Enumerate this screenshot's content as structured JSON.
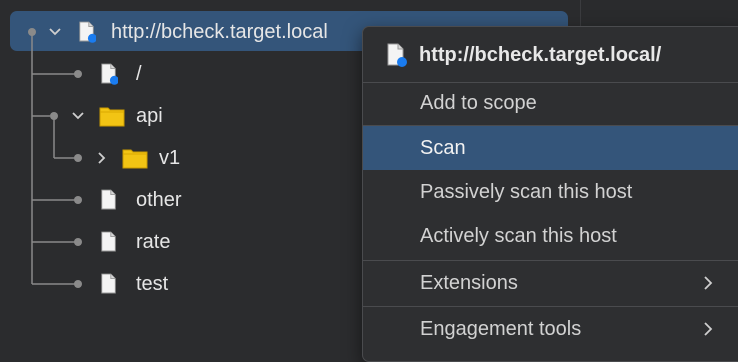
{
  "tree": {
    "root": {
      "label": "http://bcheck.target.local",
      "icon": "site-doc-icon",
      "expanded": true,
      "selected": true
    },
    "items": [
      {
        "label": "/",
        "icon": "site-doc-icon"
      },
      {
        "label": "api",
        "icon": "folder-icon",
        "expanded": true
      },
      {
        "label": "v1",
        "icon": "folder-icon",
        "expanded": false
      },
      {
        "label": "other",
        "icon": "doc-icon"
      },
      {
        "label": "rate",
        "icon": "doc-icon"
      },
      {
        "label": "test",
        "icon": "doc-icon"
      }
    ]
  },
  "context_menu": {
    "header": "http://bcheck.target.local/",
    "items": [
      {
        "label": "Add to scope",
        "active": false
      },
      {
        "label": "Scan",
        "active": true
      },
      {
        "label": "Passively scan this host",
        "active": false
      },
      {
        "label": "Actively scan this host",
        "active": false
      },
      {
        "label": "Extensions",
        "submenu": true
      },
      {
        "label": "Engagement tools",
        "submenu": true
      }
    ]
  },
  "colors": {
    "background": "#2b2c2e",
    "selection": "#34557a",
    "folder": "#f2c414",
    "badge": "#1a7cf0",
    "connector": "#8a8a8a"
  }
}
